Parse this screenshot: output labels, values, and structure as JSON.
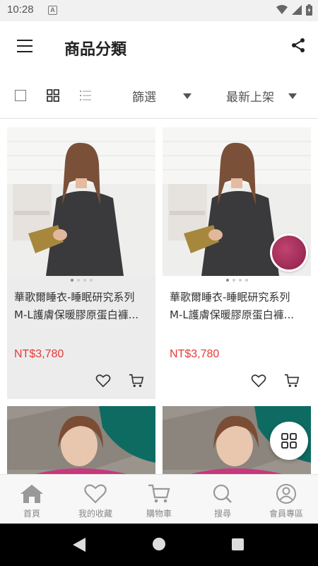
{
  "status_bar": {
    "time": "10:28",
    "notification": "A"
  },
  "header": {
    "title": "商品分類"
  },
  "toolbar": {
    "filter_label": "篩選",
    "sort_label": "最新上架"
  },
  "products": [
    {
      "name_line1": "華歌爾睡衣-睡眠研究系列",
      "name_line2": "M-L護膚保暖膠原蛋白褲...",
      "price": "NT$3,780"
    },
    {
      "name_line1": "華歌爾睡衣-睡眠研究系列",
      "name_line2": "M-L護膚保暖膠原蛋白褲...",
      "price": "NT$3,780"
    }
  ],
  "bottom_nav": [
    {
      "label": "首頁",
      "icon": "home-icon"
    },
    {
      "label": "我的收藏",
      "icon": "heart-icon"
    },
    {
      "label": "購物車",
      "icon": "cart-icon"
    },
    {
      "label": "搜尋",
      "icon": "search-icon"
    },
    {
      "label": "會員專區",
      "icon": "user-icon"
    }
  ],
  "colors": {
    "price": "#e53935",
    "swatch": "#a8305e"
  }
}
